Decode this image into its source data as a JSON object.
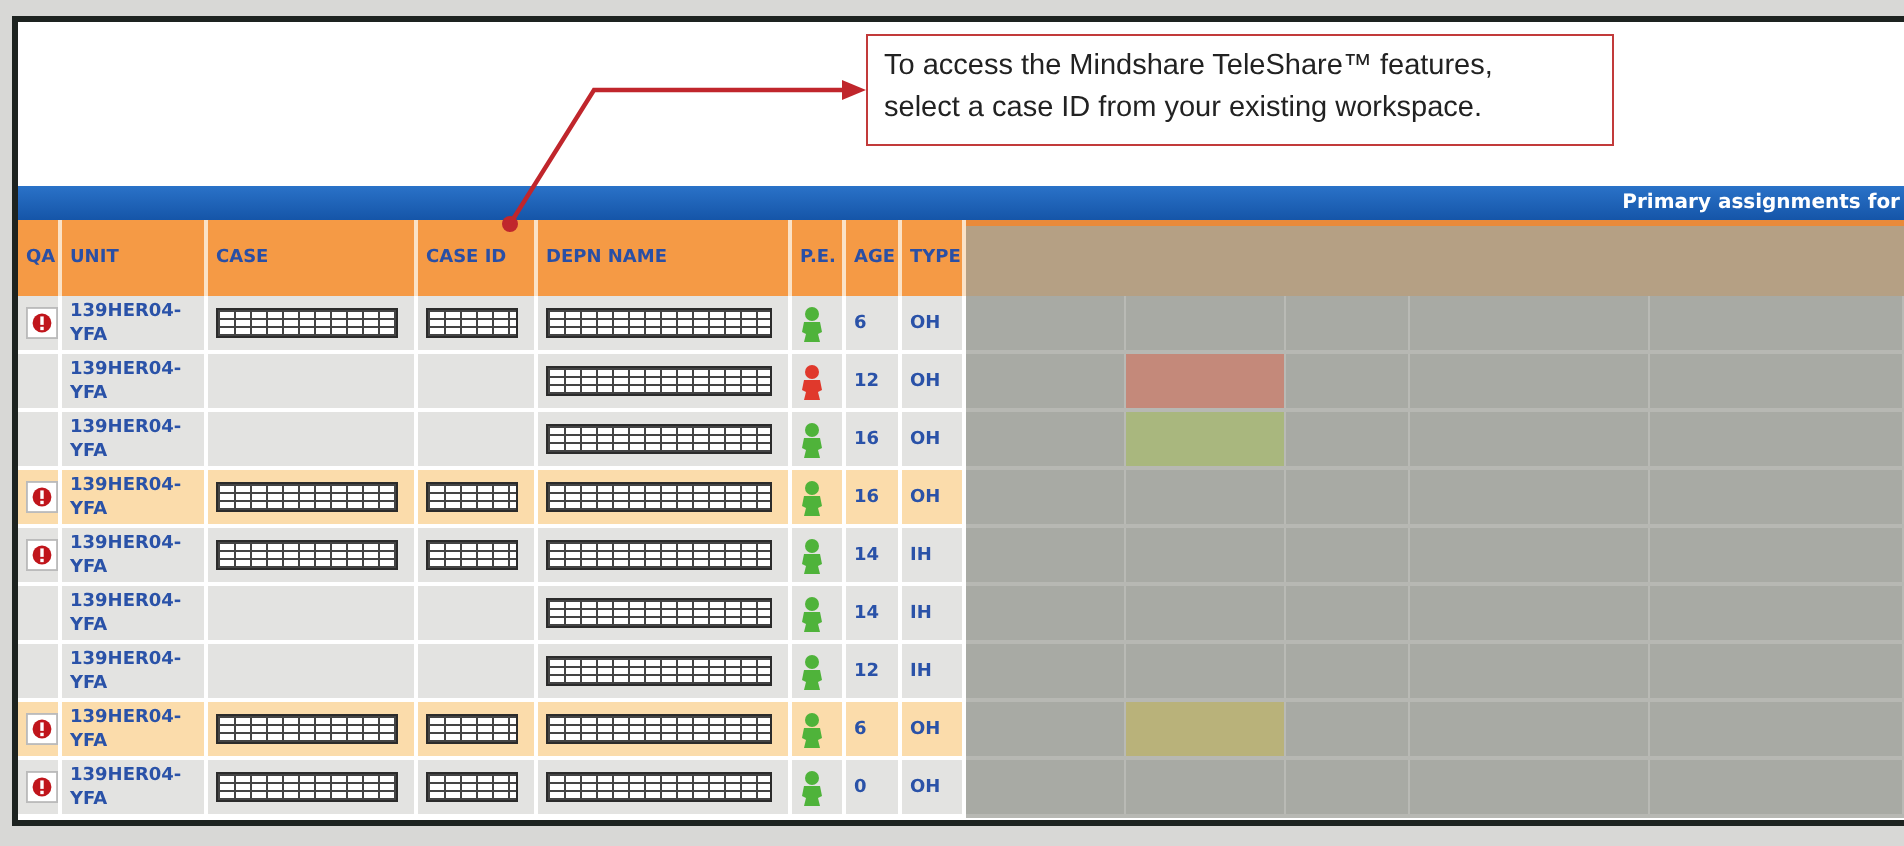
{
  "callout": {
    "text": "To access the Mindshare TeleShare™ features, select a case ID from your existing workspace."
  },
  "banner": {
    "title": "Primary assignments for"
  },
  "table": {
    "columns": [
      "QA",
      "UNIT",
      "CASE",
      "CASE ID",
      "DEPN NAME",
      "P.E.",
      "AGE",
      "TYPE"
    ],
    "rows": [
      {
        "qa_alert": true,
        "highlighted": false,
        "unit": "139HER04-YFA",
        "case_redacted": true,
        "case_id_redacted": true,
        "pe": {
          "color": "#4fb33a"
        },
        "age": "6",
        "type": "OH"
      },
      {
        "qa_alert": false,
        "highlighted": false,
        "unit": "139HER04-YFA",
        "case_redacted": false,
        "case_id_redacted": false,
        "pe": {
          "color": "#e0392c"
        },
        "age": "12",
        "type": "OH",
        "status": {
          "color": "#c4897a"
        }
      },
      {
        "qa_alert": false,
        "highlighted": false,
        "unit": "139HER04-YFA",
        "case_redacted": false,
        "case_id_redacted": false,
        "pe": {
          "color": "#4fb33a"
        },
        "age": "16",
        "type": "OH",
        "status": {
          "color": "#a9b77e"
        }
      },
      {
        "qa_alert": true,
        "highlighted": true,
        "unit": "139HER04-YFA",
        "case_redacted": true,
        "case_id_redacted": true,
        "pe": {
          "color": "#4fb33a"
        },
        "age": "16",
        "type": "OH"
      },
      {
        "qa_alert": true,
        "highlighted": false,
        "unit": "139HER04-YFA",
        "case_redacted": true,
        "case_id_redacted": true,
        "pe": {
          "color": "#4fb33a"
        },
        "age": "14",
        "type": "IH"
      },
      {
        "qa_alert": false,
        "highlighted": false,
        "unit": "139HER04-YFA",
        "case_redacted": false,
        "case_id_redacted": false,
        "pe": {
          "color": "#4fb33a"
        },
        "age": "14",
        "type": "IH"
      },
      {
        "qa_alert": false,
        "highlighted": false,
        "unit": "139HER04-YFA",
        "case_redacted": false,
        "case_id_redacted": false,
        "pe": {
          "color": "#4fb33a"
        },
        "age": "12",
        "type": "IH"
      },
      {
        "qa_alert": true,
        "highlighted": true,
        "unit": "139HER04-YFA",
        "case_redacted": true,
        "case_id_redacted": true,
        "pe": {
          "color": "#4fb33a"
        },
        "age": "6",
        "type": "OH",
        "status": {
          "color": "#b9b27a"
        }
      },
      {
        "qa_alert": true,
        "highlighted": false,
        "unit": "139HER04-YFA",
        "case_redacted": true,
        "case_id_redacted": true,
        "pe": {
          "color": "#4fb33a"
        },
        "age": "0",
        "type": "OH"
      }
    ]
  }
}
